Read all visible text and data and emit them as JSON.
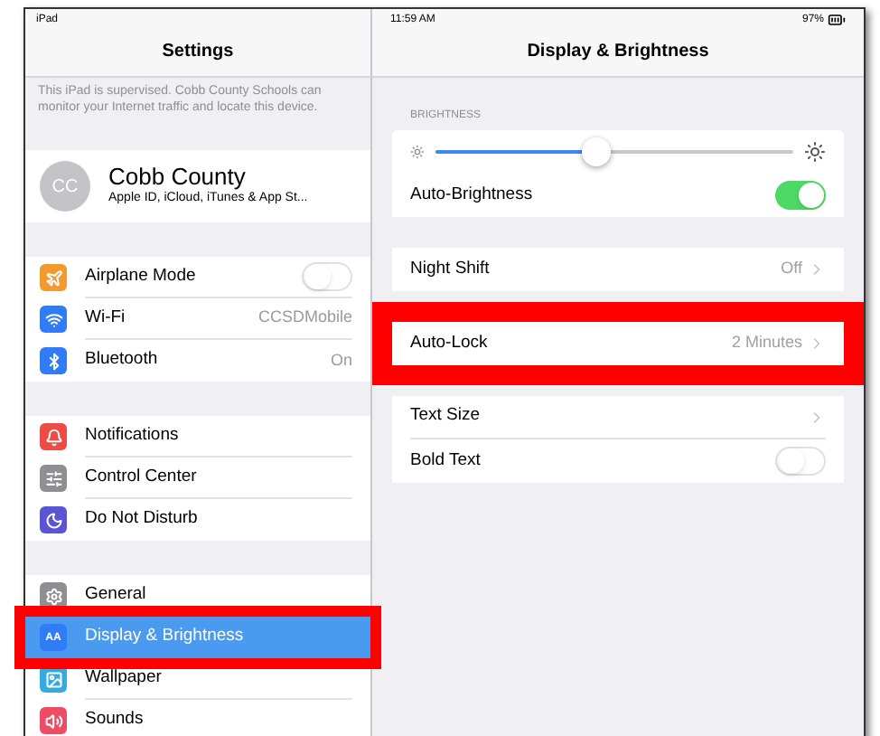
{
  "sidebar": {
    "status_left": "iPad",
    "title": "Settings",
    "notice": "This iPad is supervised. Cobb County Schools can monitor your Internet traffic and locate this device.",
    "profile": {
      "initials": "CC",
      "name": "Cobb County",
      "subtitle": "Apple ID, iCloud, iTunes & App St..."
    },
    "groups": [
      [
        {
          "label": "Airplane Mode",
          "color": "#f29a2e",
          "kind": "toggle",
          "on": false,
          "selected": false,
          "highlighted": false
        },
        {
          "label": "Wi-Fi",
          "color": "#2f7cf6",
          "kind": "value",
          "value": "CCSDMobile",
          "selected": false,
          "highlighted": false
        },
        {
          "label": "Bluetooth",
          "color": "#2f7cf6",
          "kind": "value",
          "value": "On",
          "selected": false,
          "highlighted": false
        }
      ],
      [
        {
          "label": "Notifications",
          "color": "#ee4b44",
          "kind": "plain",
          "selected": false,
          "highlighted": false
        },
        {
          "label": "Control Center",
          "color": "#8e8e93",
          "kind": "plain",
          "selected": false,
          "highlighted": false
        },
        {
          "label": "Do Not Disturb",
          "color": "#5b55d6",
          "kind": "plain",
          "selected": false,
          "highlighted": false
        }
      ],
      [
        {
          "label": "General",
          "color": "#8e8e93",
          "kind": "plain",
          "selected": false,
          "highlighted": false
        },
        {
          "label": "Display & Brightness",
          "glyph": "AA",
          "color": "#2f7cf6",
          "kind": "plain",
          "selected": true,
          "highlighted": true
        },
        {
          "label": "Wallpaper",
          "color": "#35aadc",
          "kind": "plain",
          "selected": false,
          "highlighted": false
        },
        {
          "label": "Sounds",
          "color": "#ee4b64",
          "kind": "plain",
          "selected": false,
          "highlighted": false
        }
      ]
    ]
  },
  "detail": {
    "status_time": "11:59 AM",
    "status_battery": "97%",
    "title": "Display & Brightness",
    "section_label": "BRIGHTNESS",
    "brightness": {
      "level": 0.45
    },
    "groups": [
      [
        {
          "label": "Auto-Brightness",
          "kind": "toggle",
          "on": true,
          "highlighted": false
        }
      ],
      [
        {
          "label": "Night Shift",
          "kind": "value",
          "value": "Off",
          "highlighted": false
        }
      ],
      [
        {
          "label": "Auto-Lock",
          "kind": "value",
          "value": "2 Minutes",
          "highlighted": true
        }
      ],
      [
        {
          "label": "Text Size",
          "kind": "value",
          "highlighted": false
        },
        {
          "label": "Bold Text",
          "kind": "toggle",
          "on": false,
          "highlighted": false
        }
      ]
    ]
  }
}
